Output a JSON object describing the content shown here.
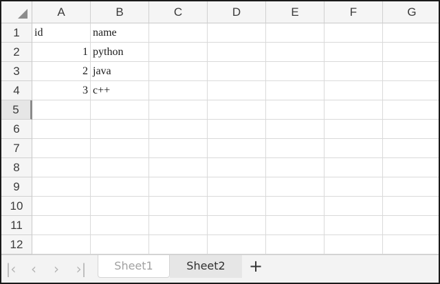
{
  "spreadsheet": {
    "columns": [
      "A",
      "B",
      "C",
      "D",
      "E",
      "F",
      "G"
    ],
    "row_numbers": [
      "1",
      "2",
      "3",
      "4",
      "5",
      "6",
      "7",
      "8",
      "9",
      "10",
      "11",
      "12"
    ],
    "active_row": "5",
    "cells": [
      [
        "id",
        "name",
        "",
        "",
        "",
        "",
        ""
      ],
      [
        "1",
        "python",
        "",
        "",
        "",
        "",
        ""
      ],
      [
        "2",
        "java",
        "",
        "",
        "",
        "",
        ""
      ],
      [
        "3",
        "c++",
        "",
        "",
        "",
        "",
        ""
      ],
      [
        "",
        "",
        "",
        "",
        "",
        "",
        ""
      ],
      [
        "",
        "",
        "",
        "",
        "",
        "",
        ""
      ],
      [
        "",
        "",
        "",
        "",
        "",
        "",
        ""
      ],
      [
        "",
        "",
        "",
        "",
        "",
        "",
        ""
      ],
      [
        "",
        "",
        "",
        "",
        "",
        "",
        ""
      ],
      [
        "",
        "",
        "",
        "",
        "",
        "",
        ""
      ],
      [
        "",
        "",
        "",
        "",
        "",
        "",
        ""
      ],
      [
        "",
        "",
        "",
        "",
        "",
        "",
        ""
      ]
    ]
  },
  "sheet_tabs": {
    "nav": [
      {
        "name": "first-sheet-icon",
        "glyph": "|‹"
      },
      {
        "name": "prev-sheet-icon",
        "glyph": "‹"
      },
      {
        "name": "next-sheet-icon",
        "glyph": "›"
      },
      {
        "name": "last-sheet-icon",
        "glyph": "›|"
      }
    ],
    "tabs": [
      {
        "label": "Sheet1",
        "active": true
      },
      {
        "label": "Sheet2",
        "active": false
      }
    ],
    "add_glyph": "+"
  },
  "colors": {
    "header_bg": "#f5f5f5",
    "gridline": "#d9d9d9",
    "active_row_header_bg": "#e6e6e6",
    "tabbar_bg": "#f3f3f3"
  }
}
